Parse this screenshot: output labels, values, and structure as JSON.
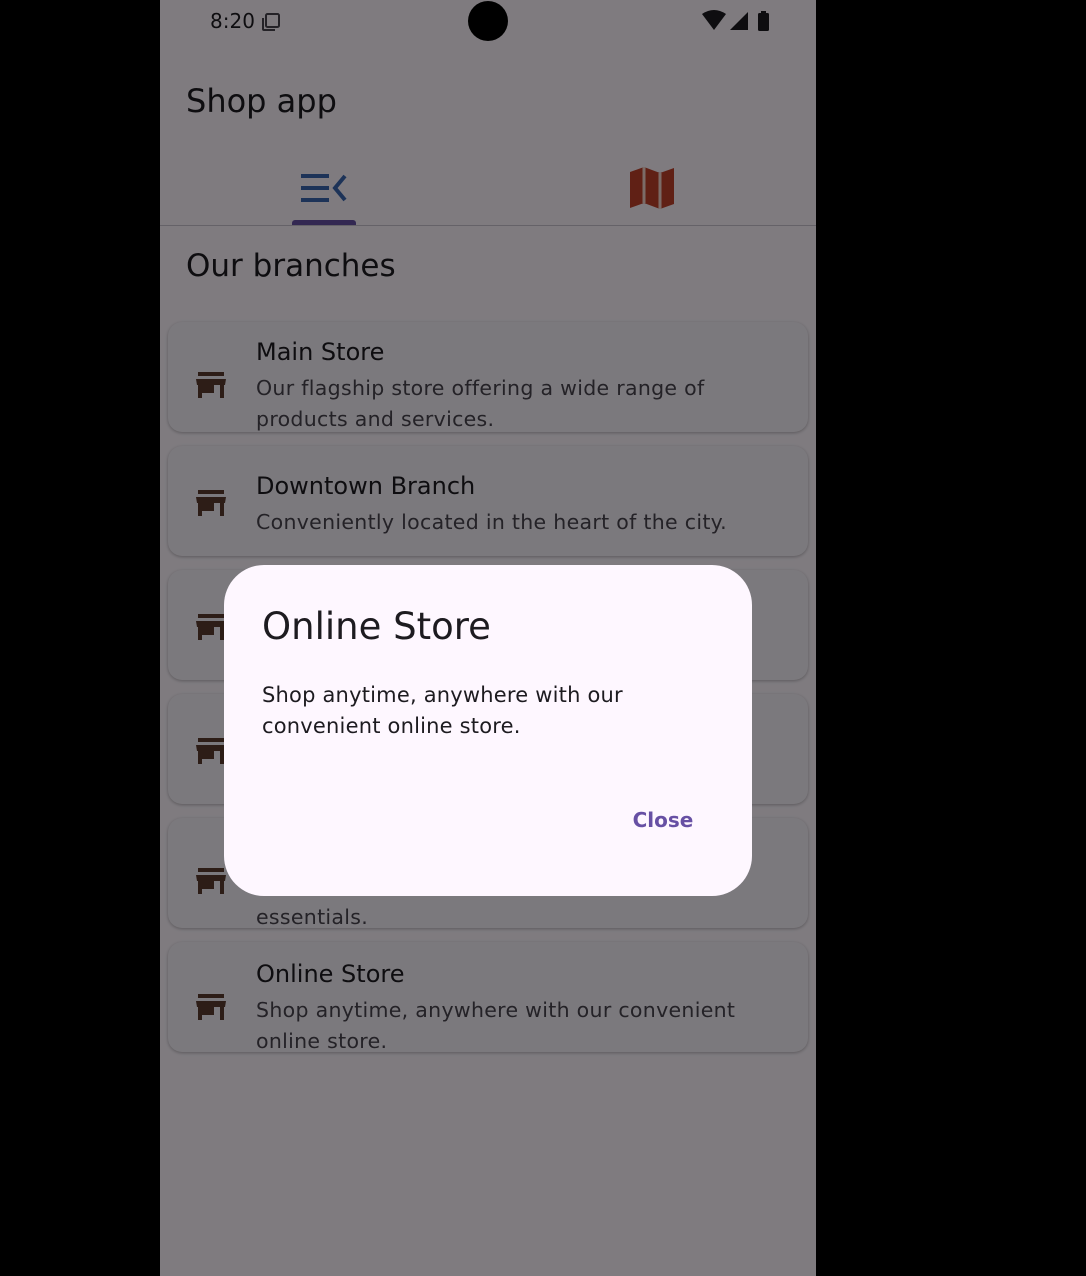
{
  "status_bar": {
    "time": "8:20",
    "icons": [
      "clipboard-icon",
      "wifi-icon",
      "signal-icon",
      "battery-icon"
    ]
  },
  "app_bar": {
    "title": "Shop app"
  },
  "tabs": [
    {
      "icon": "list-icon",
      "selected": true,
      "color": "#3b67b0"
    },
    {
      "icon": "map-icon",
      "selected": false,
      "color": "#c0412b"
    }
  ],
  "section_title": "Our branches",
  "branches": [
    {
      "name": "Main Store",
      "description": "Our flagship store offering a wide range of products and services."
    },
    {
      "name": "Downtown Branch",
      "description": "Conveniently located in the heart of the city."
    },
    {
      "name": "",
      "description": ""
    },
    {
      "name": "",
      "description": ""
    },
    {
      "name": "",
      "description": "essentials."
    },
    {
      "name": "Online Store",
      "description": "Shop anytime, anywhere with our convenient online store."
    }
  ],
  "dialog": {
    "title": "Online Store",
    "body": "Shop anytime, anywhere with our convenient online store.",
    "close_label": "Close"
  },
  "colors": {
    "accent": "#6750a4",
    "store_icon": "#5b3a2e",
    "surface": "#fef7ff",
    "card": "#f7f2fa"
  }
}
